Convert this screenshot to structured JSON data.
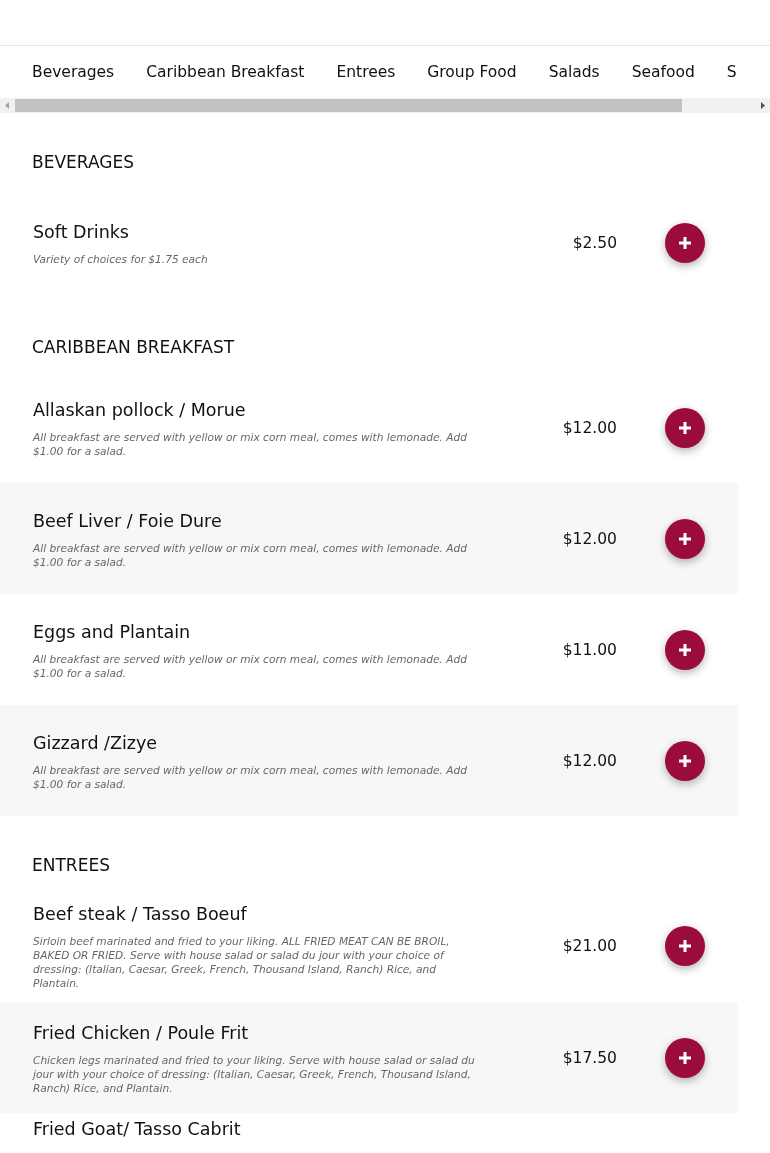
{
  "tabs": [
    {
      "label": "Beverages"
    },
    {
      "label": "Caribbean Breakfast"
    },
    {
      "label": "Entrees"
    },
    {
      "label": "Group Food"
    },
    {
      "label": "Salads"
    },
    {
      "label": "Seafood"
    },
    {
      "label": "S"
    }
  ],
  "sections": [
    {
      "heading": "BEVERAGES",
      "items": [
        {
          "name": "Soft Drinks",
          "description": "Variety of choices for $1.75 each",
          "price": "$2.50"
        }
      ]
    },
    {
      "heading": "CARIBBEAN BREAKFAST",
      "items": [
        {
          "name": "Allaskan pollock / Morue",
          "description": "All breakfast are served with yellow or mix corn meal, comes with lemonade. Add $1.00 for a salad.",
          "price": "$12.00"
        },
        {
          "name": "Beef Liver / Foie Dure",
          "description": "All breakfast are served with yellow or mix corn meal, comes with lemonade. Add $1.00 for a salad.",
          "price": "$12.00"
        },
        {
          "name": "Eggs and Plantain",
          "description": "All breakfast are served with yellow or mix corn meal, comes with lemonade. Add $1.00 for a salad.",
          "price": "$11.00"
        },
        {
          "name": "Gizzard /Zizye",
          "description": "All breakfast are served with yellow or mix corn meal, comes with lemonade. Add $1.00 for a salad.",
          "price": "$12.00"
        }
      ]
    },
    {
      "heading": "ENTREES",
      "items": [
        {
          "name": "Beef steak / Tasso Boeuf",
          "description": "Sirloin beef marinated and fried to your liking. ALL FRIED MEAT CAN BE BROIL, BAKED OR FRIED. Serve with house salad or salad du jour with your choice of dressing: (Italian, Caesar, Greek, French, Thousand Island, Ranch) Rice, and Plantain.",
          "price": "$21.00"
        },
        {
          "name": "Fried Chicken / Poule Frit",
          "description": "Chicken legs marinated and fried to your liking. Serve with house salad or salad du jour with your choice of dressing: (Italian, Caesar, Greek, French, Thousand Island, Ranch) Rice, and Plantain.",
          "price": "$17.50"
        },
        {
          "name": "Fried Goat/ Tasso Cabrit"
        }
      ]
    }
  ]
}
